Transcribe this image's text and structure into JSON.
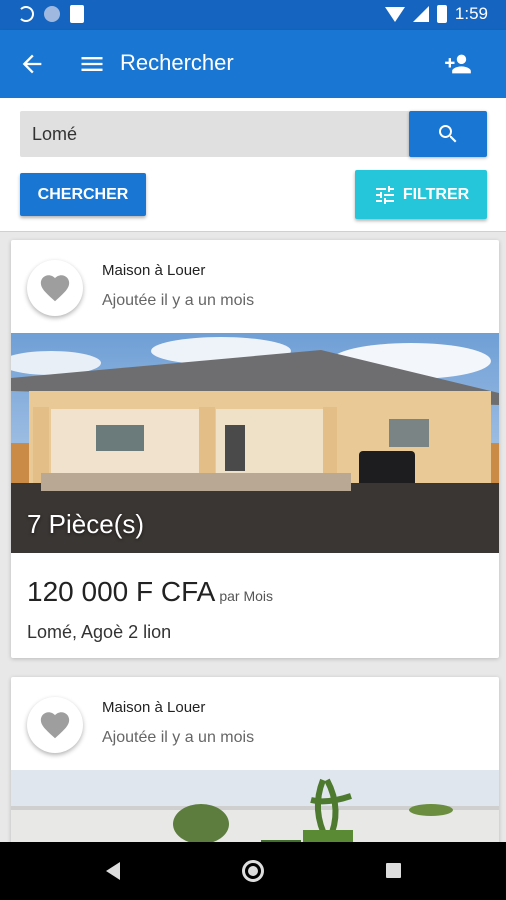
{
  "status_bar": {
    "time": "1:59"
  },
  "app_bar": {
    "title": "Rechercher"
  },
  "search": {
    "value": "Lomé",
    "placeholder": ""
  },
  "buttons": {
    "chercher_label": "CHERCHER",
    "filtrer_label": "FILTRER"
  },
  "listings": [
    {
      "type": "Maison à Louer",
      "added": "Ajoutée il y a un mois",
      "rooms": "7 Pièce(s)",
      "price": "120 000 F CFA",
      "period": "par Mois",
      "location": "Lomé, Agoè 2 lion"
    },
    {
      "type": "Maison à Louer",
      "added": "Ajoutée il y a un mois"
    }
  ],
  "colors": {
    "primary": "#1976d2",
    "primary_dark": "#1565c0",
    "accent": "#26c6da",
    "favorite_icon": "#9e9e9e"
  },
  "icons": [
    "sync-icon",
    "circle-icon",
    "sd-card-icon",
    "wifi-icon",
    "signal-icon",
    "battery-icon",
    "arrow-back-icon",
    "menu-icon",
    "person-add-icon",
    "search-icon",
    "tune-icon",
    "heart-icon",
    "nav-back-icon",
    "nav-home-icon",
    "nav-recent-icon"
  ]
}
